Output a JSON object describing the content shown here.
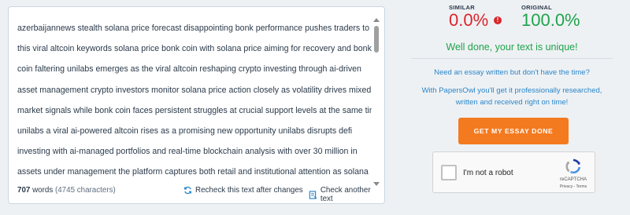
{
  "text_panel": {
    "lines": [
      "azerbaijannews stealth solana price forecast disappointing bonk performance pushes traders to",
      "this viral altcoin keywords solana price bonk coin with solana price aiming for recovery and bonk",
      "coin faltering unilabs emerges as the viral altcoin reshaping crypto investing through ai-driven",
      "asset management crypto investors monitor solana price action closely as volatility drives mixed",
      "market signals while bonk coin faces persistent struggles at crucial support levels at the same time",
      "unilabs a viral ai-powered altcoin rises as a promising new opportunity unilabs disrupts defi",
      "investing with ai-managed portfolios and real-time blockchain analysis with over 30 million in",
      "assets under management the platform captures both retail and institutional attention as solana"
    ],
    "word_count": "707",
    "words_label": "words",
    "char_count": "(4745 characters)",
    "recheck_label": "Recheck this text after changes",
    "check_another_label": "Check another text"
  },
  "results": {
    "similar_label": "SIMILAR",
    "similar_value": "0.0%",
    "original_label": "ORIGINAL",
    "original_value": "100.0%",
    "warning_mark": "!",
    "unique_message": "Well done, your text is unique!",
    "promo_question": "Need an essay written but don't have the time?",
    "promo_line1": "With PapersOwl you'll get it professionally researched,",
    "promo_line2": "written and received right on time!",
    "cta_label": "GET MY ESSAY DONE"
  },
  "recaptcha": {
    "label": "I'm not a robot",
    "brand": "reCAPTCHA",
    "links": "Privacy - Terms"
  },
  "colors": {
    "similar": "#d9252a",
    "original": "#1fa34a",
    "link": "#2a86c9",
    "cta": "#f47a1f"
  },
  "icons": [
    "recheck-icon",
    "check-another-icon",
    "info-icon",
    "recaptcha-logo-icon"
  ]
}
